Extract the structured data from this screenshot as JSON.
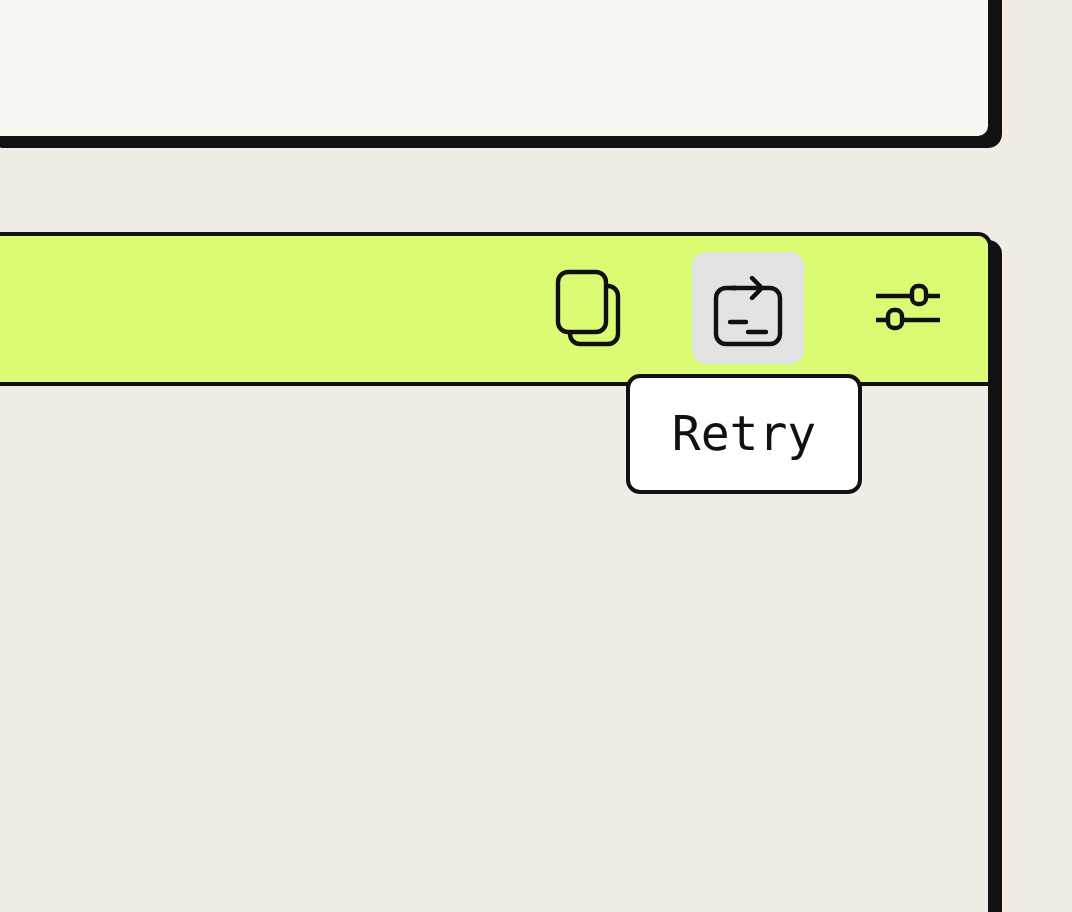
{
  "toolbar": {
    "buttons": [
      {
        "kind": "copy",
        "hovered": false
      },
      {
        "kind": "retry",
        "hovered": true
      },
      {
        "kind": "settings",
        "hovered": false
      }
    ]
  },
  "tooltip": {
    "text": "Retry"
  }
}
